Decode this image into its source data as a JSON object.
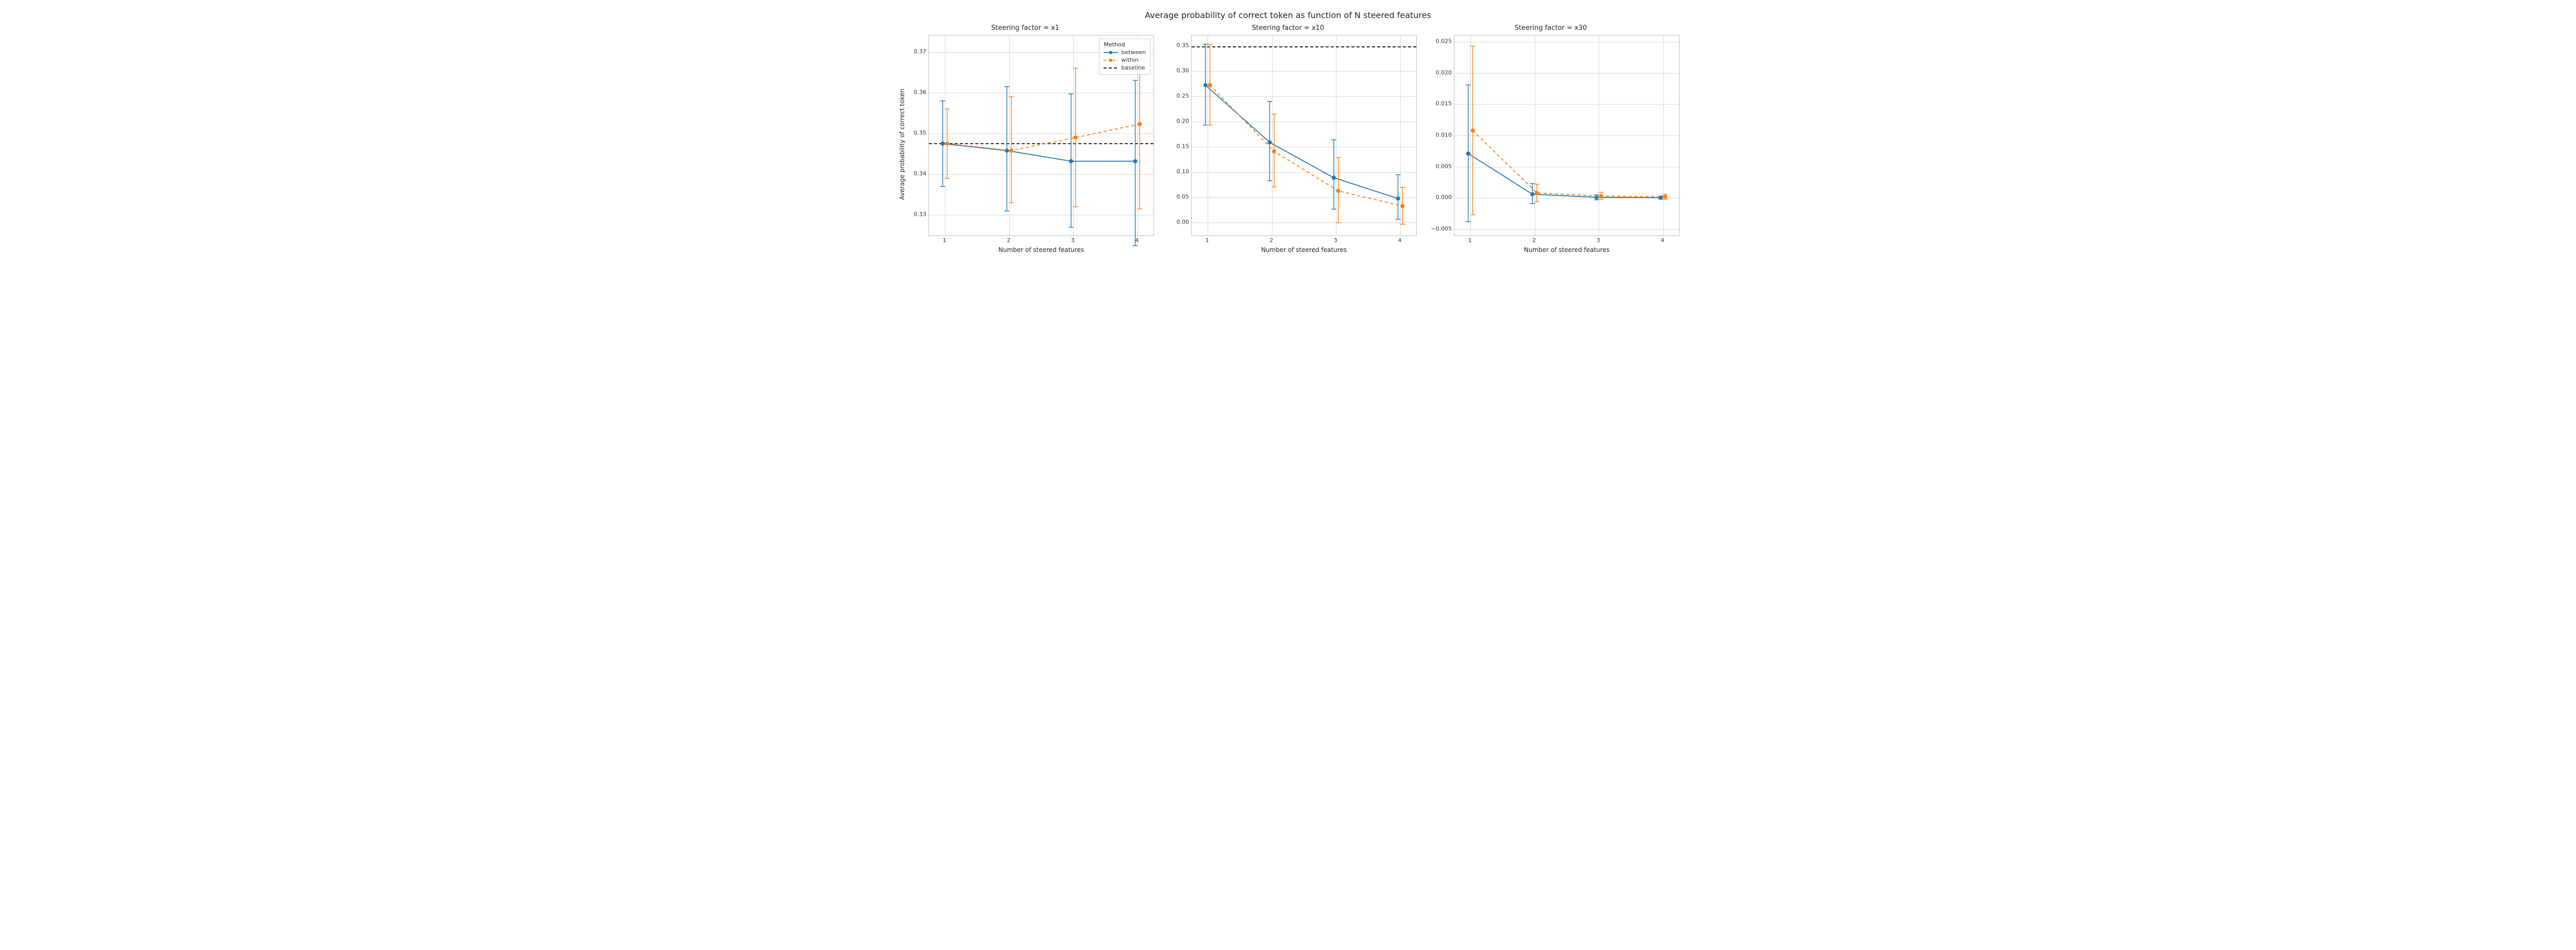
{
  "suptitle": "Average probability of correct token as function of N steered features",
  "ylabel": "Average probability of correct token",
  "xlabel": "Number of steered features",
  "xticks": [
    1,
    2,
    3,
    4
  ],
  "colors": {
    "between": "#1f77b4",
    "within": "#ff7f0e",
    "baseline": "#000000"
  },
  "legend": {
    "title": "Method",
    "items": [
      {
        "key": "between",
        "label": "between"
      },
      {
        "key": "within",
        "label": "within"
      },
      {
        "key": "baseline",
        "label": "baseline"
      }
    ]
  },
  "chart_data": [
    {
      "title": "Steering factor = x1",
      "show_ylabel": true,
      "show_legend": true,
      "ylim": [
        0.325,
        0.374
      ],
      "yticks": [
        0.33,
        0.34,
        0.35,
        0.36,
        0.37
      ],
      "ytick_labels": [
        "0.33",
        "0.34",
        "0.35",
        "0.36",
        "0.37"
      ],
      "baseline": 0.3475,
      "series": [
        {
          "name": "between",
          "x": [
            1,
            2,
            3,
            4
          ],
          "y": [
            0.3475,
            0.3458,
            0.3432,
            0.3432
          ],
          "ylo": [
            0.337,
            0.331,
            0.327,
            0.3225
          ],
          "yhi": [
            0.358,
            0.3615,
            0.3597,
            0.363
          ]
        },
        {
          "name": "within",
          "x": [
            1,
            2,
            3,
            4
          ],
          "y": [
            0.3475,
            0.3458,
            0.349,
            0.3523
          ],
          "ylo": [
            0.339,
            0.333,
            0.332,
            0.3315
          ],
          "yhi": [
            0.356,
            0.359,
            0.366,
            0.372
          ]
        }
      ]
    },
    {
      "title": "Steering factor = x10",
      "show_ylabel": false,
      "show_legend": false,
      "ylim": [
        -0.025,
        0.37
      ],
      "yticks": [
        0.0,
        0.05,
        0.1,
        0.15,
        0.2,
        0.25,
        0.3,
        0.35
      ],
      "ytick_labels": [
        "0.00",
        "0.05",
        "0.10",
        "0.15",
        "0.20",
        "0.25",
        "0.30",
        "0.35"
      ],
      "baseline": 0.3475,
      "series": [
        {
          "name": "between",
          "x": [
            1,
            2,
            3,
            4
          ],
          "y": [
            0.272,
            0.159,
            0.089,
            0.048
          ],
          "ylo": [
            0.193,
            0.083,
            0.027,
            0.007
          ],
          "yhi": [
            0.353,
            0.24,
            0.164,
            0.095
          ]
        },
        {
          "name": "within",
          "x": [
            1,
            2,
            3,
            4
          ],
          "y": [
            0.272,
            0.141,
            0.063,
            0.033
          ],
          "ylo": [
            0.193,
            0.071,
            0.0,
            -0.003
          ],
          "yhi": [
            0.353,
            0.215,
            0.129,
            0.07
          ]
        }
      ]
    },
    {
      "title": "Steering factor = x30",
      "show_ylabel": false,
      "show_legend": false,
      "ylim": [
        -0.006,
        0.026
      ],
      "yticks": [
        -0.005,
        0.0,
        0.005,
        0.01,
        0.015,
        0.02,
        0.025
      ],
      "ytick_labels": [
        "−0.005",
        "0.000",
        "0.005",
        "0.010",
        "0.015",
        "0.020",
        "0.025"
      ],
      "baseline": null,
      "series": [
        {
          "name": "between",
          "x": [
            1,
            2,
            3,
            4
          ],
          "y": [
            0.0071,
            0.0006,
            0.0001,
            5e-05
          ],
          "ylo": [
            -0.0038,
            -0.0009,
            -0.0003,
            -0.0002
          ],
          "yhi": [
            0.0181,
            0.0023,
            0.0005,
            0.0003
          ]
        },
        {
          "name": "within",
          "x": [
            1,
            2,
            3,
            4
          ],
          "y": [
            0.0108,
            0.0008,
            0.0003,
            0.0002
          ],
          "ylo": [
            -0.0027,
            -0.0006,
            -0.0002,
            -0.0002
          ],
          "yhi": [
            0.0243,
            0.0022,
            0.0009,
            0.0006
          ]
        }
      ]
    }
  ]
}
